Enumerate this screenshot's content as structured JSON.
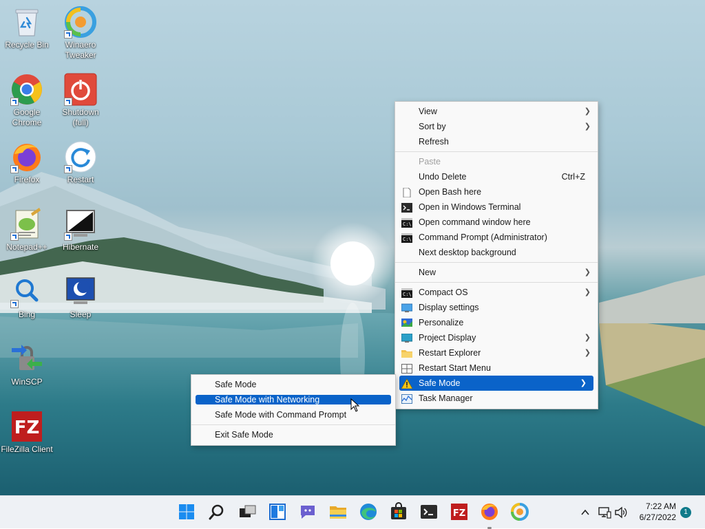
{
  "desktop_icons": [
    {
      "label": "Recycle Bin",
      "icon": "recycle-bin-icon"
    },
    {
      "label": "Winaero Tweaker",
      "icon": "winaero-tweaker-icon"
    },
    {
      "label": "Google Chrome",
      "icon": "chrome-icon"
    },
    {
      "label": "Shutdown (full)",
      "icon": "shutdown-icon"
    },
    {
      "label": "Firefox",
      "icon": "firefox-icon"
    },
    {
      "label": "Restart",
      "icon": "restart-icon"
    },
    {
      "label": "Notepad++",
      "icon": "notepadpp-icon"
    },
    {
      "label": "Hibernate",
      "icon": "hibernate-icon"
    },
    {
      "label": "Bing",
      "icon": "bing-search-icon"
    },
    {
      "label": "Sleep",
      "icon": "sleep-icon"
    },
    {
      "label": "WinSCP",
      "icon": "winscp-icon"
    },
    {
      "label": "FileZilla Client",
      "icon": "filezilla-icon"
    }
  ],
  "context_menu": {
    "items": [
      {
        "label": "View"
      },
      {
        "label": "Sort by"
      },
      {
        "label": "Refresh"
      },
      {
        "label": "Paste"
      },
      {
        "label": "Undo Delete",
        "shortcut": "Ctrl+Z"
      },
      {
        "label": "Open Bash here",
        "icon": "file-icon"
      },
      {
        "label": "Open in Windows Terminal",
        "icon": "terminal-icon"
      },
      {
        "label": "Open command window here",
        "icon": "cmd-icon"
      },
      {
        "label": "Command Prompt (Administrator)",
        "icon": "cmd-icon"
      },
      {
        "label": "Next desktop background"
      },
      {
        "label": "New"
      },
      {
        "label": "Compact OS",
        "icon": "cmd-icon"
      },
      {
        "label": "Display settings",
        "icon": "display-icon"
      },
      {
        "label": "Personalize",
        "icon": "personalize-icon"
      },
      {
        "label": "Project Display",
        "icon": "project-display-icon"
      },
      {
        "label": "Restart Explorer",
        "icon": "folder-icon"
      },
      {
        "label": "Restart Start Menu",
        "icon": "start-menu-icon"
      },
      {
        "label": "Safe Mode",
        "icon": "warning-icon"
      },
      {
        "label": "Task Manager",
        "icon": "task-manager-icon"
      }
    ]
  },
  "submenu": {
    "items": [
      {
        "label": "Safe Mode"
      },
      {
        "label": "Safe Mode with Networking"
      },
      {
        "label": "Safe Mode with Command Prompt"
      },
      {
        "label": "Exit Safe Mode"
      }
    ]
  },
  "taskbar": {
    "apps": [
      "start-icon",
      "search-icon",
      "task-view-icon",
      "widgets-icon",
      "teams-chat-icon",
      "file-explorer-icon",
      "edge-icon",
      "store-icon",
      "terminal-icon",
      "filezilla-icon",
      "firefox-icon",
      "winaero-tweaker-icon"
    ],
    "tray": [
      "chevron-up-icon",
      "network-icon",
      "volume-icon"
    ],
    "time": "7:22 AM",
    "date": "6/27/2022",
    "notification_count": "1"
  },
  "colors": {
    "menu_highlight": "#0a63c9",
    "taskbar_bg": "#eef1f5",
    "notification_badge": "#0f7a8a"
  }
}
